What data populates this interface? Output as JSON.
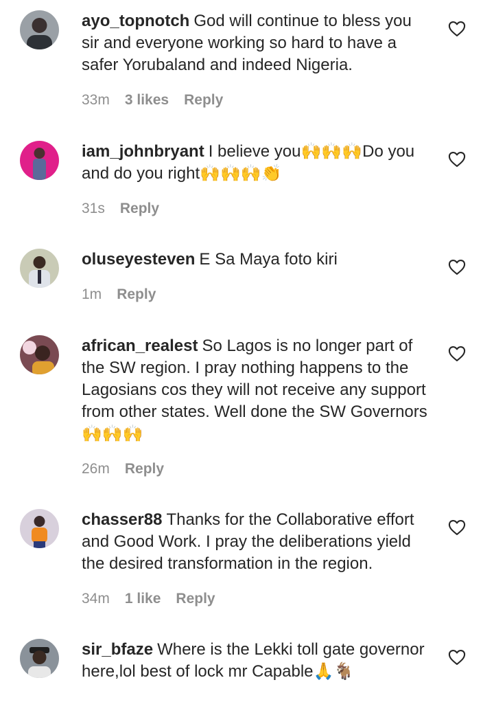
{
  "comments": [
    {
      "username": "ayo_topnotch",
      "text": "God will continue to bless you sir and everyone working so hard to have a safer Yorubaland and indeed Nigeria.",
      "time": "33m",
      "likes": "3 likes",
      "reply": "Reply",
      "avatar_color": "#4a4f57"
    },
    {
      "username": "iam_johnbryant",
      "text": "I believe you🙌🙌🙌Do you and do you right🙌🙌🙌👏",
      "time": "31s",
      "likes": "",
      "reply": "Reply",
      "avatar_color": "#e0208a"
    },
    {
      "username": "oluseyesteven",
      "text": "E Sa Maya foto kiri",
      "time": "1m",
      "likes": "",
      "reply": "Reply",
      "avatar_color": "#b7b9a4"
    },
    {
      "username": "african_realest",
      "text": "So Lagos is no longer part of the SW region. I pray nothing happens to the Lagosians cos they will not receive any support from other states. Well done the SW Governors🙌🙌🙌",
      "time": "26m",
      "likes": "",
      "reply": "Reply",
      "avatar_color": "#8a5a4a"
    },
    {
      "username": "chasser88",
      "text": "Thanks for the Collaborative effort and Good Work. I pray the deliberations yield the desired transformation in the region.",
      "time": "34m",
      "likes": "1 like",
      "reply": "Reply",
      "avatar_color": "#c8b8c8"
    },
    {
      "username": "sir_bfaze",
      "text": "Where is the Lekki toll gate governor here,lol best of lock mr Capable🙏🐐",
      "time": "",
      "likes": "",
      "reply": "",
      "avatar_color": "#6f7780"
    }
  ],
  "icons": {
    "heart": "heart-outline-icon"
  },
  "colors": {
    "text": "#262626",
    "meta": "#8e8e8e"
  }
}
